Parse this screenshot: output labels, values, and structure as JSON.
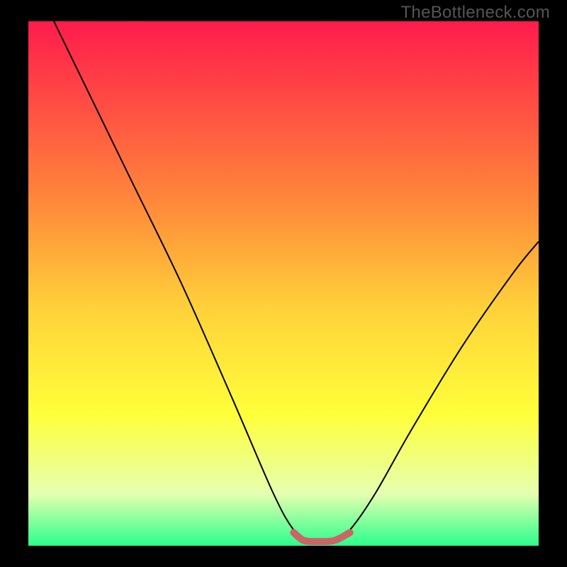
{
  "attribution": "TheBottleneck.com",
  "chart_data": {
    "type": "line",
    "title": "",
    "xlabel": "",
    "ylabel": "",
    "xlim": [
      0,
      100
    ],
    "ylim": [
      0,
      100
    ],
    "background_gradient": {
      "stops": [
        {
          "pct": 0,
          "color": "#ff1b4c"
        },
        {
          "pct": 35,
          "color": "#ff8a3a"
        },
        {
          "pct": 55,
          "color": "#ffd23a"
        },
        {
          "pct": 75,
          "color": "#ffff3a"
        },
        {
          "pct": 90,
          "color": "#e6ffb0"
        },
        {
          "pct": 100,
          "color": "#2cff8c"
        }
      ]
    },
    "series": [
      {
        "name": "bottleneck-curve",
        "points": [
          {
            "x": 5,
            "y": 100
          },
          {
            "x": 10,
            "y": 90
          },
          {
            "x": 20,
            "y": 70
          },
          {
            "x": 30,
            "y": 50
          },
          {
            "x": 40,
            "y": 28
          },
          {
            "x": 48,
            "y": 10
          },
          {
            "x": 52,
            "y": 3
          },
          {
            "x": 55,
            "y": 1
          },
          {
            "x": 60,
            "y": 1
          },
          {
            "x": 63,
            "y": 3
          },
          {
            "x": 68,
            "y": 10
          },
          {
            "x": 75,
            "y": 22
          },
          {
            "x": 85,
            "y": 38
          },
          {
            "x": 95,
            "y": 52
          },
          {
            "x": 100,
            "y": 58
          }
        ]
      },
      {
        "name": "optimal-plateau",
        "points": [
          {
            "x": 52,
            "y": 2.5
          },
          {
            "x": 54,
            "y": 1.0
          },
          {
            "x": 57,
            "y": 0.8
          },
          {
            "x": 60,
            "y": 1.0
          },
          {
            "x": 63,
            "y": 2.5
          }
        ]
      }
    ]
  }
}
